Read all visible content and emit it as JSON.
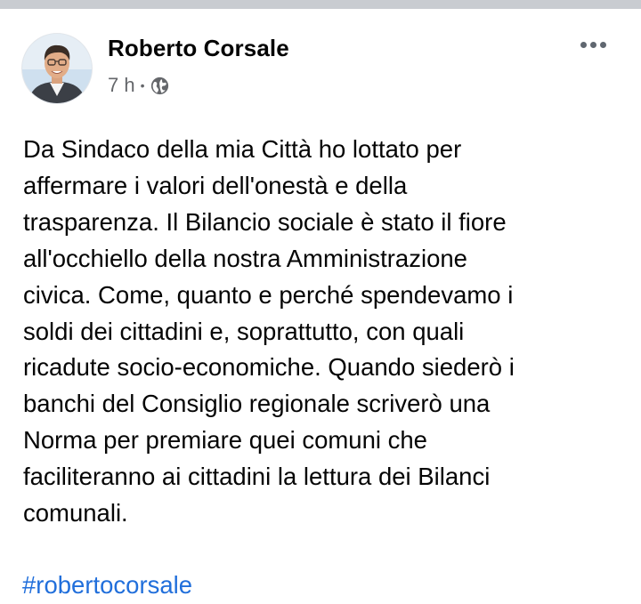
{
  "post": {
    "author": "Roberto Corsale",
    "time": "7 h",
    "separator": "•",
    "privacy_icon": "globe-icon",
    "more_icon": "more-options-icon",
    "body_lines": [
      "Da Sindaco della mia Città ho lottato per",
      "affermare i valori dell'onestà e della",
      "trasparenza. Il Bilancio sociale è stato il fiore",
      "all'occhiello della nostra Amministrazione",
      "civica. Come, quanto e perché spendevamo i",
      "soldi dei cittadini e, soprattutto, con quali",
      "ricadute socio-economiche. Quando siederò i",
      "banchi del Consiglio regionale scriverò una",
      "Norma per premiare quei comuni che",
      "faciliteranno ai cittadini la lettura dei Bilanci",
      "comunali."
    ],
    "hashtag": "#robertocorsale"
  },
  "colors": {
    "name": "#050505",
    "meta": "#65676b",
    "link": "#216fdb",
    "divider": "#c9ccd1"
  }
}
